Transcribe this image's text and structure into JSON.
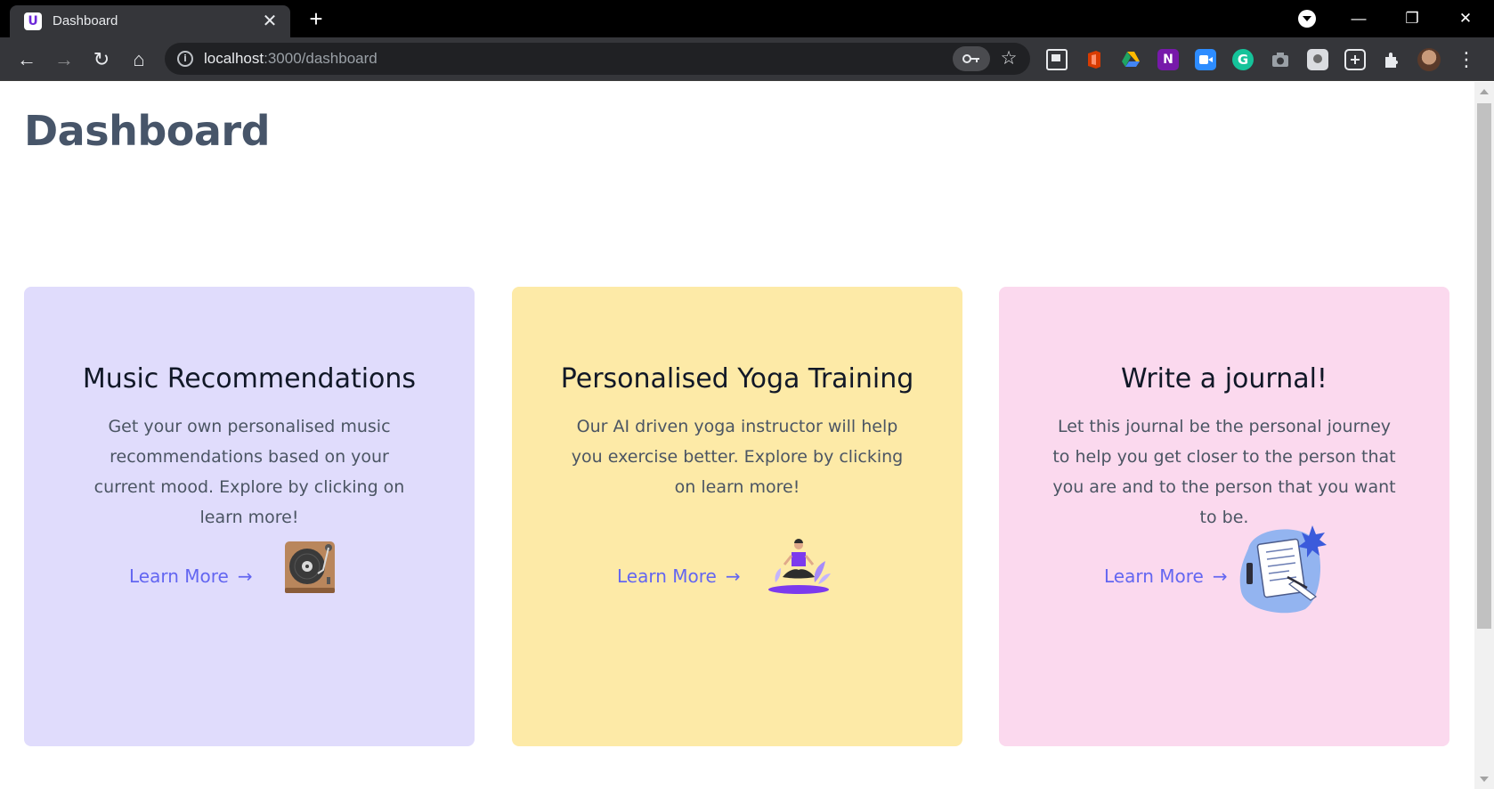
{
  "browser": {
    "tab": {
      "title": "Dashboard",
      "favicon_letter": "U",
      "close_glyph": "✕"
    },
    "new_tab_glyph": "+",
    "window_controls": {
      "minimize": "—",
      "restore": "❐",
      "close": "✕"
    },
    "nav": {
      "back": "←",
      "forward": "→",
      "reload": "↻",
      "home": "⌂"
    },
    "address": {
      "host": "localhost",
      "path": ":3000/dashboard"
    },
    "key_icon": "key-icon",
    "star_glyph": "☆",
    "menu_glyph": "⋮",
    "extensions": [
      {
        "name": "media-control-icon",
        "color": "#e8eaed"
      },
      {
        "name": "office-icon",
        "color": "#d83b01"
      },
      {
        "name": "google-drive-icon",
        "color": "#1fa463"
      },
      {
        "name": "onenote-icon",
        "color": "#7719aa"
      },
      {
        "name": "zoom-icon",
        "color": "#2d8cff"
      },
      {
        "name": "grammarly-icon",
        "color": "#15c39a"
      },
      {
        "name": "screenshot-icon",
        "color": "#9aa0a6"
      },
      {
        "name": "extension-tile-icon",
        "color": "#dadce0"
      },
      {
        "name": "notes-icon",
        "color": "#e8eaed"
      },
      {
        "name": "puzzle-icon",
        "color": "#e8eaed"
      }
    ]
  },
  "page": {
    "title": "Dashboard",
    "cards": [
      {
        "title": "Music Recommendations",
        "description": "Get your own personalised music recommendations based on your current mood. Explore by clicking on learn more!",
        "link": "Learn More",
        "arrow": "→",
        "bg": "#e0dcfc",
        "illustration": "turntable-icon"
      },
      {
        "title": "Personalised Yoga Training",
        "description": "Our AI driven yoga instructor will help you exercise better. Explore by clicking on learn more!",
        "link": "Learn More",
        "arrow": "→",
        "bg": "#fdeaa7",
        "illustration": "yoga-person-icon"
      },
      {
        "title": "Write a journal!",
        "description": "Let this journal be the personal journey to help you get closer to the person that you are and to the person that you want to be.",
        "link": "Learn More",
        "arrow": "→",
        "bg": "#fbd9ee",
        "illustration": "journal-writing-icon"
      }
    ]
  }
}
